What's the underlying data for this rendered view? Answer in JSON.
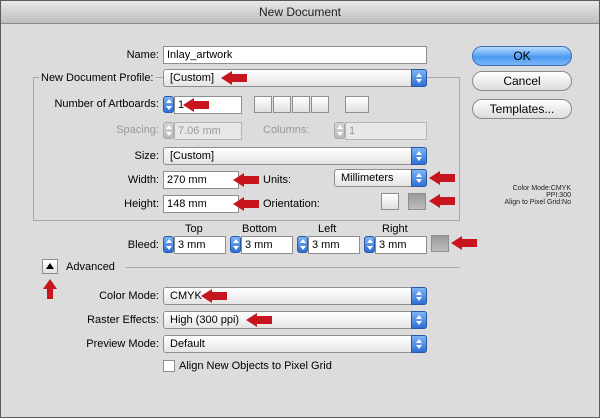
{
  "window": {
    "title": "New Document"
  },
  "name": {
    "label": "Name:",
    "value": "Inlay_artwork"
  },
  "profile": {
    "label": "New Document Profile:",
    "value": "[Custom]"
  },
  "artboards": {
    "label": "Number of Artboards:",
    "value": "1"
  },
  "spacing": {
    "label": "Spacing:",
    "value": "7.06 mm"
  },
  "columns": {
    "label": "Columns:",
    "value": "1"
  },
  "size": {
    "label": "Size:",
    "value": "[Custom]"
  },
  "width": {
    "label": "Width:",
    "value": "270 mm"
  },
  "units": {
    "label": "Units:",
    "value": "Millimeters"
  },
  "height": {
    "label": "Height:",
    "value": "148 mm"
  },
  "orientation": {
    "label": "Orientation:"
  },
  "bleed": {
    "label": "Bleed:",
    "top_label": "Top",
    "bottom_label": "Bottom",
    "left_label": "Left",
    "right_label": "Right",
    "top": "3 mm",
    "bottom": "3 mm",
    "left": "3 mm",
    "right": "3 mm"
  },
  "advanced": {
    "label": "Advanced",
    "color_mode_label": "Color Mode:",
    "color_mode": "CMYK",
    "raster_label": "Raster Effects:",
    "raster": "High (300 ppi)",
    "preview_label": "Preview Mode:",
    "preview": "Default",
    "align_label": "Align New Objects to Pixel Grid"
  },
  "buttons": {
    "ok": "OK",
    "cancel": "Cancel",
    "templates": "Templates..."
  },
  "summary": {
    "color_mode": "Color Mode:CMYK",
    "ppi": "PPI:300",
    "align": "Align to Pixel Grid:No"
  },
  "colors": {
    "arrow": "#c8141c",
    "accent": "#2f6fd6"
  }
}
